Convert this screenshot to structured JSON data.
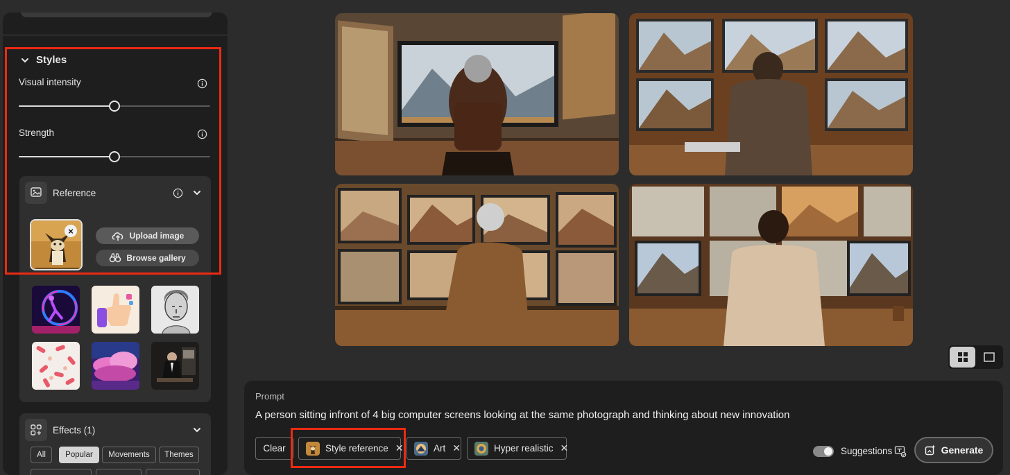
{
  "styles": {
    "title": "Styles",
    "visual_intensity": {
      "label": "Visual intensity",
      "value_fraction": 0.5
    },
    "strength": {
      "label": "Strength",
      "value_fraction": 0.5
    },
    "reference": {
      "label": "Reference",
      "upload_label": "Upload image",
      "gallery_label": "Browse gallery"
    },
    "style_thumbnails": [
      "neon-figure",
      "thumbs-up-3d",
      "sketch-portrait",
      "pattern-hands",
      "pink-clouds",
      "man-in-suit"
    ]
  },
  "effects": {
    "title": "Effects (1)",
    "filters": [
      "All",
      "Popular",
      "Movements",
      "Themes"
    ],
    "active_filter": "Popular"
  },
  "view": {
    "selected": "grid"
  },
  "prompt": {
    "title": "Prompt",
    "text": "A person sitting infront of 4 big computer screens looking at the same photograph and thinking about new innovation",
    "chips": [
      {
        "label": "Style reference"
      },
      {
        "label": "Art"
      },
      {
        "label": "Hyper realistic"
      }
    ],
    "clear_label": "Clear",
    "suggestions_label": "Suggestions",
    "generate_label": "Generate"
  },
  "colors": {
    "highlight": "#ec2a14",
    "panel": "#1e1e1e",
    "background": "#2c2c2c"
  }
}
